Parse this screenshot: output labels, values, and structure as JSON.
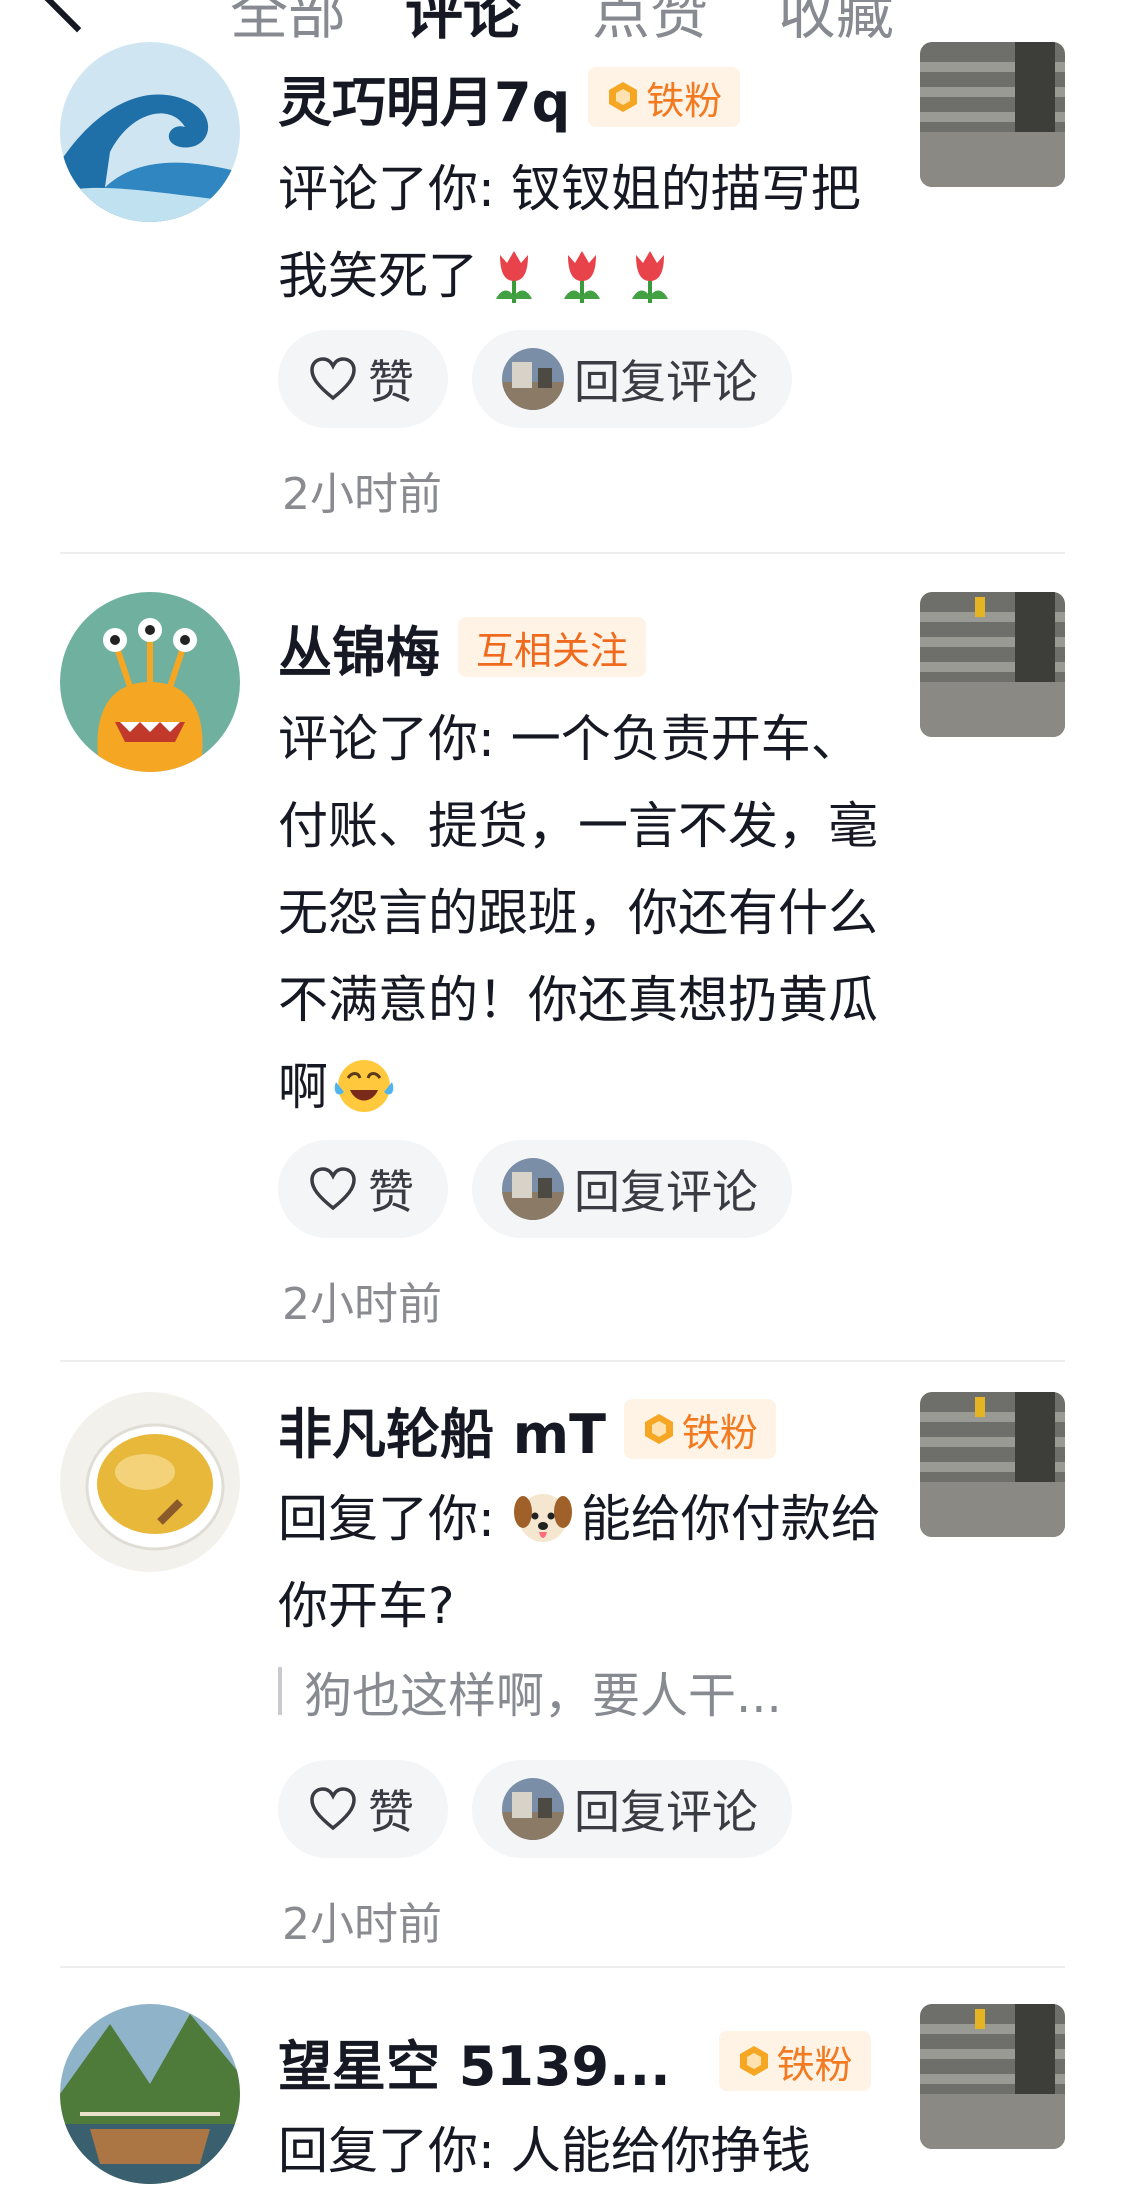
{
  "tabs": [
    "全部",
    "评论",
    "点赞",
    "收藏"
  ],
  "active_tab": "评论",
  "reply_button_label": "回复评论",
  "like_button_label": "赞",
  "items": [
    {
      "name": "灵巧明月7q",
      "badge": "铁粉",
      "badge_type": "iron-fan",
      "comment": "评论了你: 钗钗姐的描写把我笑死了",
      "emoji": [
        "tulip-emoji",
        "tulip-emoji",
        "tulip-emoji"
      ],
      "time": "2小时前"
    },
    {
      "name": "丛锦梅",
      "badge": "互相关注",
      "badge_type": "mutual-follow",
      "comment": "评论了你: 一个负责开车、付账、提货，一言不发，毫无怨言的跟班，你还有什么不满意的！你还真想扔黄瓜啊",
      "emoji": [
        "laughing-crying-emoji"
      ],
      "time": "2小时前"
    },
    {
      "name": "非凡轮船 mT",
      "badge": "铁粉",
      "badge_type": "iron-fan",
      "comment_prefix": "回复了你: ",
      "emoji": [
        "dog-face-emoji"
      ],
      "comment": "能给你付款给你开车?",
      "quote": "狗也这样啊，要人干...",
      "time": "2小时前"
    },
    {
      "name": "望星空 5139...",
      "badge": "铁粉",
      "badge_type": "iron-fan",
      "comment": "回复了你: 人能给你挣钱"
    }
  ],
  "colors": {
    "badge_text": "#f27b22",
    "badge_bg": "#fff3e6",
    "pill_bg": "#f4f5f7",
    "muted_text": "#8a8b91"
  }
}
